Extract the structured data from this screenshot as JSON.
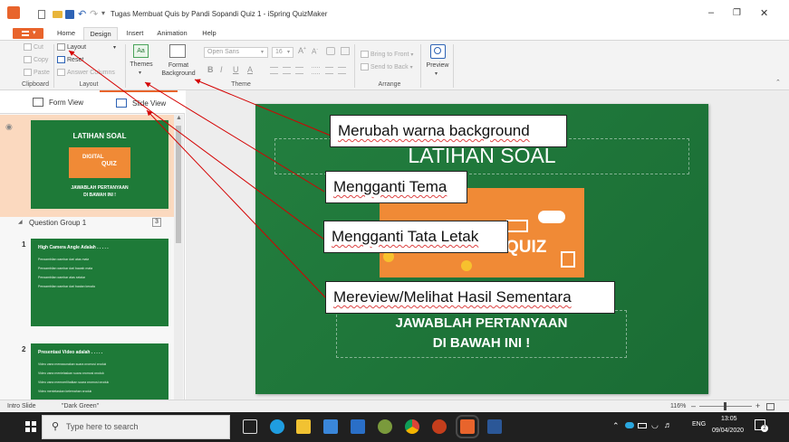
{
  "window": {
    "title": "Tugas Membuat Quis by Pandi Sopandi Quiz 1 - iSpring QuizMaker",
    "minimize": "–",
    "restore": "❐",
    "close": "✕"
  },
  "tabs": [
    "Home",
    "Design",
    "Insert",
    "Animation",
    "Help"
  ],
  "ribbon": {
    "clipboard": {
      "cut": "Cut",
      "copy": "Copy",
      "paste": "Paste",
      "label": "Clipboard"
    },
    "layout": {
      "layout": "Layout",
      "reset": "Reset",
      "answer_columns": "Answer Columns",
      "label": "Layout"
    },
    "theme": {
      "themes": "Themes",
      "format_background_1": "Format",
      "format_background_2": "Background",
      "font_name": "Open Sans",
      "font_size": "16",
      "bold": "B",
      "italic": "I",
      "underline": "U",
      "font_color": "A",
      "label": "Theme"
    },
    "arrange": {
      "bring_to_front": "Bring to Front",
      "send_to_back": "Send to Back",
      "label": "Arrange"
    },
    "preview": {
      "preview": "Preview"
    }
  },
  "left_panel": {
    "form_view": "Form View",
    "slide_view": "Slide View",
    "intro_thumb": {
      "title": "LATIHAN SOAL",
      "badge_1": "DIGITAL",
      "badge_2": "QUIZ",
      "sub_1": "JAWABLAH PERTANYAAN",
      "sub_2": "DI BAWAH INI !"
    },
    "group": {
      "label": "Question Group 1",
      "count": "3"
    },
    "slides": [
      {
        "num": "1",
        "title": "High Camera Angle Adalah . . . . .",
        "options": [
          "Pengambilan gambar dari atas mata",
          "Pengambilan gambar dari bawah mata",
          "Pengambilan gambar atas sejajar",
          "Pengambilan gambar dari bagian kepala"
        ]
      },
      {
        "num": "2",
        "title": "Presentasi Video adalah . . . . .",
        "options": [
          "Video yang menggunakan suara promosi produk",
          "Video yang menjelaskan suara promosi produk",
          "Video yang memperlihatkan suara promosi produk",
          "Video menjelaskan kelemahan produk"
        ]
      }
    ]
  },
  "slide": {
    "title": "LATIHAN SOAL",
    "quiz_word": "QUIZ",
    "sub_1": "JAWABLAH PERTANYAAN",
    "sub_2": "DI BAWAH INI !"
  },
  "callouts": {
    "background": "Merubah warna background",
    "theme": "Mengganti Tema",
    "layout": "Mengganti Tata Letak",
    "preview": "Mereview/Melihat Hasil Sementara"
  },
  "status": {
    "slide_type": "Intro Slide",
    "theme_name": "\"Dark Green\"",
    "zoom": "116%",
    "zoom_minus": "–",
    "zoom_plus": "+"
  },
  "taskbar": {
    "search_placeholder": "Type here to search",
    "lang": "ENG",
    "time": "13:05",
    "date": "09/04/2020",
    "notif_count": "2"
  },
  "colors": {
    "accent": "#e8642c",
    "slide_green": "#1e7a38",
    "callout_line": "#d40000",
    "taskbar": "#202020"
  }
}
